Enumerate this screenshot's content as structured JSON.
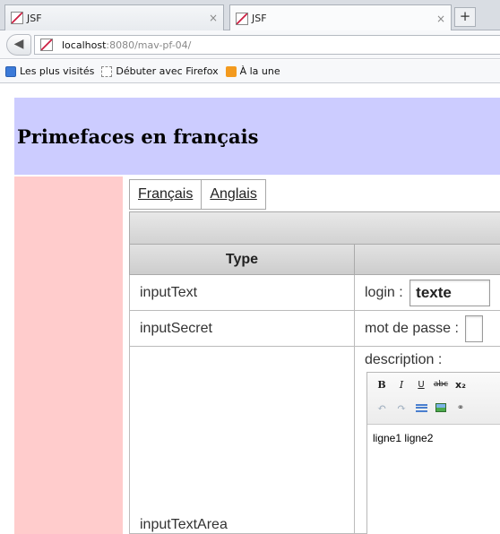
{
  "browser": {
    "tabs": [
      {
        "title": "JSF",
        "close": "×"
      },
      {
        "title": "JSF",
        "close": "×"
      }
    ],
    "new_tab": "+",
    "back": "◀",
    "url_host": "localhost",
    "url_path": ":8080/mav-pf-04/",
    "bookmarks": [
      "Les plus visités",
      "Débuter avec Firefox",
      "À la une"
    ]
  },
  "page": {
    "title": "Primefaces en français",
    "languages": [
      "Français",
      "Anglais"
    ],
    "table": {
      "column_type": "Type",
      "rows": [
        {
          "type": "inputText",
          "label": "login :",
          "value": "texte"
        },
        {
          "type": "inputSecret",
          "label": "mot de passe :",
          "value": ""
        },
        {
          "type": "inputTextArea",
          "label": "description :",
          "value": "ligne1 ligne2"
        }
      ]
    },
    "editor_toolbar": {
      "row1": [
        "B",
        "I",
        "U",
        "abc",
        "x₂"
      ],
      "row2": [
        "undo-icon",
        "redo-icon",
        "align-icon",
        "image-icon",
        "link-icon"
      ]
    }
  }
}
